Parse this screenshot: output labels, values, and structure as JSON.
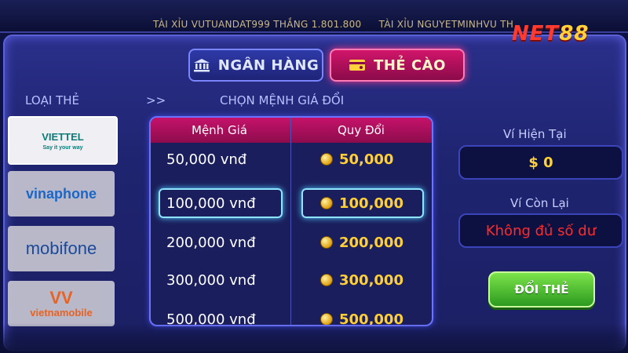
{
  "ticker": [
    "TÀI XỈU VUTUANDAT999 THẮNG 1.801.800",
    "TÀI XỈU NGUYETMINHVU TH"
  ],
  "logo": {
    "text": "NET",
    "num": "88"
  },
  "tabs": {
    "bank": "NGÂN HÀNG",
    "card": "THẺ CÀO"
  },
  "labels": {
    "card_type": "LOẠI THẺ",
    "arrows": ">>",
    "choose_value": "CHỌN MỆNH GIÁ ĐỔI"
  },
  "providers": [
    {
      "name": "VIETTEL",
      "sub": "Say it your way"
    },
    {
      "name": "vinaphone"
    },
    {
      "name": "mobifone"
    },
    {
      "name": "vietnamobile"
    }
  ],
  "table": {
    "col_value": "Mệnh Giá",
    "col_exchange": "Quy Đổi",
    "rows": [
      {
        "value": "50,000 vnđ",
        "exchange": "50,000"
      },
      {
        "value": "100,000 vnđ",
        "exchange": "100,000"
      },
      {
        "value": "200,000 vnđ",
        "exchange": "200,000"
      },
      {
        "value": "300,000 vnđ",
        "exchange": "300,000"
      },
      {
        "value": "500,000 vnđ",
        "exchange": "500,000"
      }
    ],
    "selected_index": 1
  },
  "wallet": {
    "current_label": "Ví Hiện Tại",
    "current_value": "$ 0",
    "remaining_label": "Ví Còn Lại",
    "remaining_value": "Không đủ số dư"
  },
  "exchange_button": "ĐỔI THẺ",
  "colors": {
    "accent_pink": "#c5126a",
    "gold": "#ffcf3a",
    "error_red": "#ff2a2a",
    "button_green": "#2c9a1f"
  },
  "icons": [
    "bank-icon",
    "card-icon",
    "coin-icon"
  ]
}
